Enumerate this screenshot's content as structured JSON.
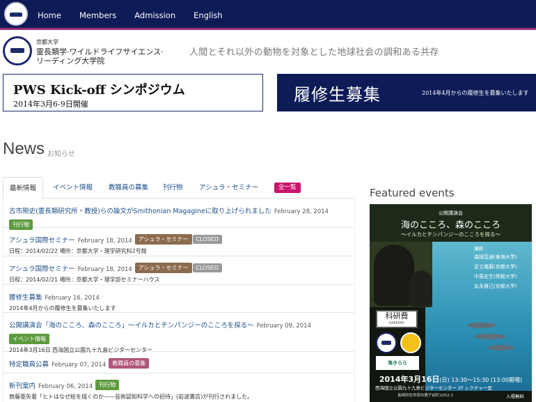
{
  "nav": {
    "items": [
      "Home",
      "Members",
      "Admission",
      "English"
    ]
  },
  "site": {
    "university": "京都大学",
    "name_line1": "霊長類学·ワイルドライフサイエンス·",
    "name_line2": "リーディング大学院",
    "tagline": "人間とそれ以外の動物を対象とした地球社会の調和ある共存"
  },
  "banners": {
    "left_title": "PWS Kick-off シンポジウム",
    "left_date": "2014年3月6-9日開催",
    "right_title": "履修生募集",
    "right_sub": "2014年4月からの履修生を募集いたします"
  },
  "news": {
    "title": "News",
    "subtitle": "お知らせ",
    "tabs": [
      "最新情報",
      "イベント情報",
      "教職員の募集",
      "刊行物",
      "アシュラ・セミナー"
    ],
    "all_label": "全一覧",
    "items": [
      {
        "title": "古市剛史(霊長類研究所・教授)らの論文がSmithonian Magagineに取り上げられました",
        "date": "February 28, 2014",
        "badge": "刊行物",
        "closed": "",
        "detail": ""
      },
      {
        "title": "アシュラ国際セミナー",
        "date": "February 18, 2014",
        "badge": "アシュラ・セミナー",
        "closed": "CLOSED",
        "detail": "日程：2014/02/22 場所：京都大学・理学研究科2号館"
      },
      {
        "title": "アシュラ国際セミナー",
        "date": "February 18, 2014",
        "badge": "アシュラ・セミナー",
        "closed": "CLOSED",
        "detail": "日程：2014/02/21 場所：京都大学・理学部セミナーハウス"
      },
      {
        "title": "履修生募集",
        "date": "February 16, 2014",
        "badge": "",
        "closed": "",
        "detail": "2014年4月からの履修生を募集いたします"
      },
      {
        "title": "公開講演会「海のこころ、森のこころ」～イルカとチンパンジーのこころを探る～",
        "date": "February 09, 2014",
        "badge": "イベント情報",
        "closed": "",
        "detail": "2014年3月16日 西海国立公園九十九島ビジターセンター"
      },
      {
        "title": "特定職員公募",
        "date": "February 07, 2014",
        "badge": "教職員の募集",
        "closed": "",
        "detail": ""
      },
      {
        "title": "新刊案内",
        "date": "February 06, 2014",
        "badge": "刊行物",
        "closed": "",
        "detail": "齋藤亜矢著「ヒトはなぜ絵を描くのか——芸術認知科学への招待」(岩波書店)が刊行されました。"
      }
    ]
  },
  "featured": {
    "title": "Featured events",
    "poster": {
      "heading": "公開講演会",
      "title": "海のこころ、森のこころ",
      "subtitle": "～イルカとチンパンジーのこころを探る～",
      "speakers_label": "講師",
      "speakers": [
        "森阪匡通(東海大学)",
        "足立幾磨(京都大学)",
        "中原史生(常磐大学)",
        "友永雅己(京都大学)"
      ],
      "kaken": "科研費",
      "kaken_sub": "KAKENHI",
      "kaiyukan": "海きらら",
      "date_bold": "2014年3月16日",
      "date_rest": "(日) 13:30～15:30 (13:00開場)",
      "venue": "西海国立公園九十九島ビジターセンター 2F レクチャー室",
      "address": "長崎県佐世保市鹿子前町1052-2",
      "free": "入場無料"
    }
  }
}
